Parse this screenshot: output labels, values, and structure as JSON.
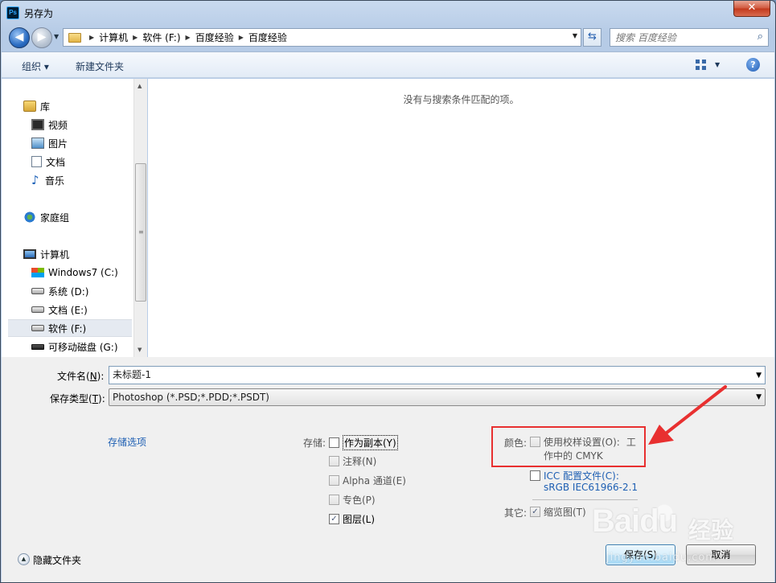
{
  "window": {
    "title": "另存为",
    "close_glyph": "✕"
  },
  "address": {
    "crumbs": [
      "计算机",
      "软件 (F:)",
      "百度经验",
      "百度经验"
    ],
    "search_placeholder": "搜索 百度经验"
  },
  "toolbar": {
    "organize": "组织 ▾",
    "new_folder": "新建文件夹"
  },
  "nav": {
    "items": [
      {
        "label": "库",
        "icon": "library-icon"
      },
      {
        "label": "视频",
        "icon": "video-icon"
      },
      {
        "label": "图片",
        "icon": "picture-icon"
      },
      {
        "label": "文档",
        "icon": "document-icon"
      },
      {
        "label": "音乐",
        "icon": "music-icon"
      },
      {
        "label": "家庭组",
        "icon": "homegroup-icon"
      },
      {
        "label": "计算机",
        "icon": "computer-icon"
      },
      {
        "label": "Windows7 (C:)",
        "icon": "windows-drive-icon"
      },
      {
        "label": "系统 (D:)",
        "icon": "drive-icon"
      },
      {
        "label": "文档 (E:)",
        "icon": "drive-icon"
      },
      {
        "label": "软件 (F:)",
        "icon": "drive-icon",
        "selected": true
      },
      {
        "label": "可移动磁盘 (G:)",
        "icon": "removable-drive-icon"
      }
    ]
  },
  "content": {
    "empty_message": "没有与搜索条件匹配的项。"
  },
  "form": {
    "filename_label_pre": "文件名(",
    "filename_label_key": "N",
    "filename_label_post": "):",
    "filename_value": "未标题-1",
    "type_label_pre": "保存类型(",
    "type_label_key": "T",
    "type_label_post": "):",
    "type_value": "Photoshop (*.PSD;*.PDD;*.PSDT)"
  },
  "options": {
    "save_options_link": "存储选项",
    "save_label": "存储:",
    "as_copy": "作为副本(Y)",
    "notes": "注释(N)",
    "alpha": "Alpha 通道(E)",
    "spot": "专色(P)",
    "layers": "图层(L)",
    "color_label": "颜色:",
    "use_proof_1": "使用校样设置(O):",
    "use_proof_2": "工",
    "use_proof_3": "作中的 CMYK",
    "icc_1": "ICC 配置文件(C):",
    "icc_2": "sRGB IEC61966-2.1",
    "other_label": "其它:",
    "thumbnail": "缩览图(T)"
  },
  "footer": {
    "hide_folders": "隐藏文件夹",
    "save_button": "保存(S)",
    "cancel_button": "取消"
  },
  "watermark": {
    "logo": "Baidu",
    "jingyan": "经验",
    "url": "jingyan.baidu.com"
  },
  "colors": {
    "highlight_red": "#e83030",
    "link_blue": "#1e5fb3"
  }
}
